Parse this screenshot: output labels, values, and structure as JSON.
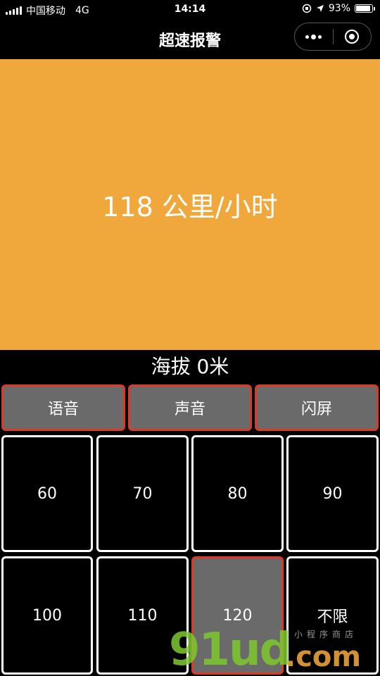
{
  "status_bar": {
    "carrier": "中国移动",
    "network": "4G",
    "time": "14:14",
    "battery_percent": "93%",
    "battery_level": 0.93
  },
  "nav": {
    "title": "超速报警"
  },
  "speed": {
    "text": "118 公里/小时",
    "panel_color": "#f0a83c"
  },
  "altitude": {
    "text": "海拔 0米"
  },
  "modes": [
    {
      "label": "语音"
    },
    {
      "label": "声音"
    },
    {
      "label": "闪屏"
    }
  ],
  "limits": [
    {
      "label": "60",
      "selected": false
    },
    {
      "label": "70",
      "selected": false
    },
    {
      "label": "80",
      "selected": false
    },
    {
      "label": "90",
      "selected": false
    },
    {
      "label": "100",
      "selected": false
    },
    {
      "label": "110",
      "selected": false
    },
    {
      "label": "120",
      "selected": true
    },
    {
      "label": "不限",
      "selected": false
    }
  ],
  "watermark": {
    "main": "91ud",
    "domain": ".com",
    "sub": "小程序商店"
  },
  "colors": {
    "accent_border": "#d93a2a",
    "button_gray": "#6a6a6a",
    "watermark_green": "#7ec92f",
    "watermark_orange": "#e9a23a"
  }
}
